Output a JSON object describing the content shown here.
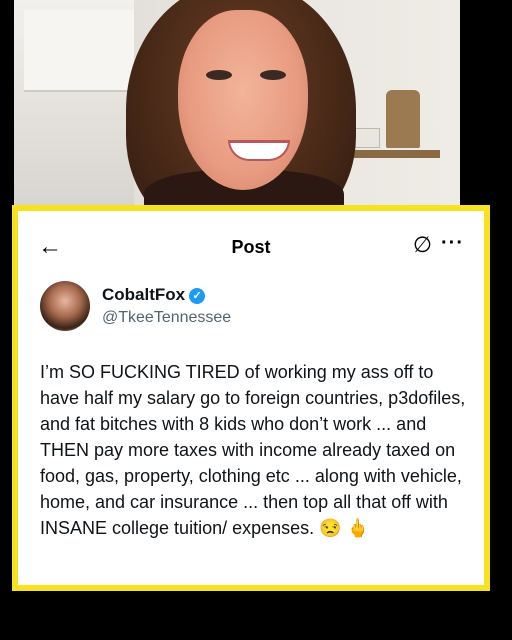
{
  "header": {
    "back_icon": "back-arrow-icon",
    "title": "Post",
    "mute_icon": "slashed-circle-icon",
    "more_icon": "more-horizontal-icon"
  },
  "author": {
    "name": "CobaltFox",
    "verified_icon": "verified-badge-icon",
    "handle": "@TkeeTennessee"
  },
  "post": {
    "text": "I’m SO FUCKING  TIRED of working my ass off to have half my salary go to foreign countries, p3dofiles, and fat bitches with 8 kids who don’t work ... and THEN pay more taxes with income already taxed on food, gas, property, clothing etc ... along with vehicle, home, and car insurance ... then top all that off with INSANE college tuition/ expenses. 😒 🖕"
  },
  "colors": {
    "frame": "#f6e21e",
    "verified": "#1d9bf0",
    "handle": "#536471"
  }
}
